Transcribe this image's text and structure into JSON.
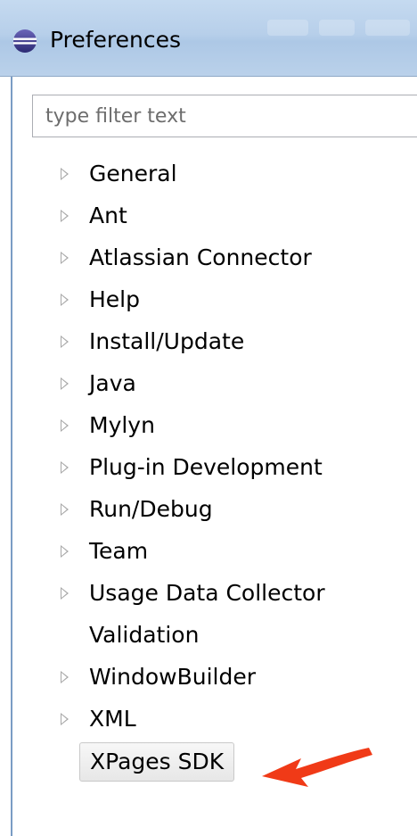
{
  "window": {
    "title": "Preferences",
    "icon": "eclipse-icon"
  },
  "filter": {
    "placeholder": "type filter text",
    "value": ""
  },
  "tree": {
    "items": [
      {
        "label": "General",
        "expandable": true
      },
      {
        "label": "Ant",
        "expandable": true
      },
      {
        "label": "Atlassian Connector",
        "expandable": true
      },
      {
        "label": "Help",
        "expandable": true
      },
      {
        "label": "Install/Update",
        "expandable": true
      },
      {
        "label": "Java",
        "expandable": true
      },
      {
        "label": "Mylyn",
        "expandable": true
      },
      {
        "label": "Plug-in Development",
        "expandable": true
      },
      {
        "label": "Run/Debug",
        "expandable": true
      },
      {
        "label": "Team",
        "expandable": true
      },
      {
        "label": "Usage Data Collector",
        "expandable": true
      },
      {
        "label": "Validation",
        "expandable": false
      },
      {
        "label": "WindowBuilder",
        "expandable": true
      },
      {
        "label": "XML",
        "expandable": true
      },
      {
        "label": "XPages SDK",
        "expandable": false,
        "selected": true
      }
    ]
  },
  "annotation": {
    "icon": "red-arrow-icon",
    "color": "#f03a17"
  },
  "colors": {
    "titlebar": "#b7cfea",
    "expander": "#a8a8a8",
    "selection": "#e7e7e7"
  }
}
